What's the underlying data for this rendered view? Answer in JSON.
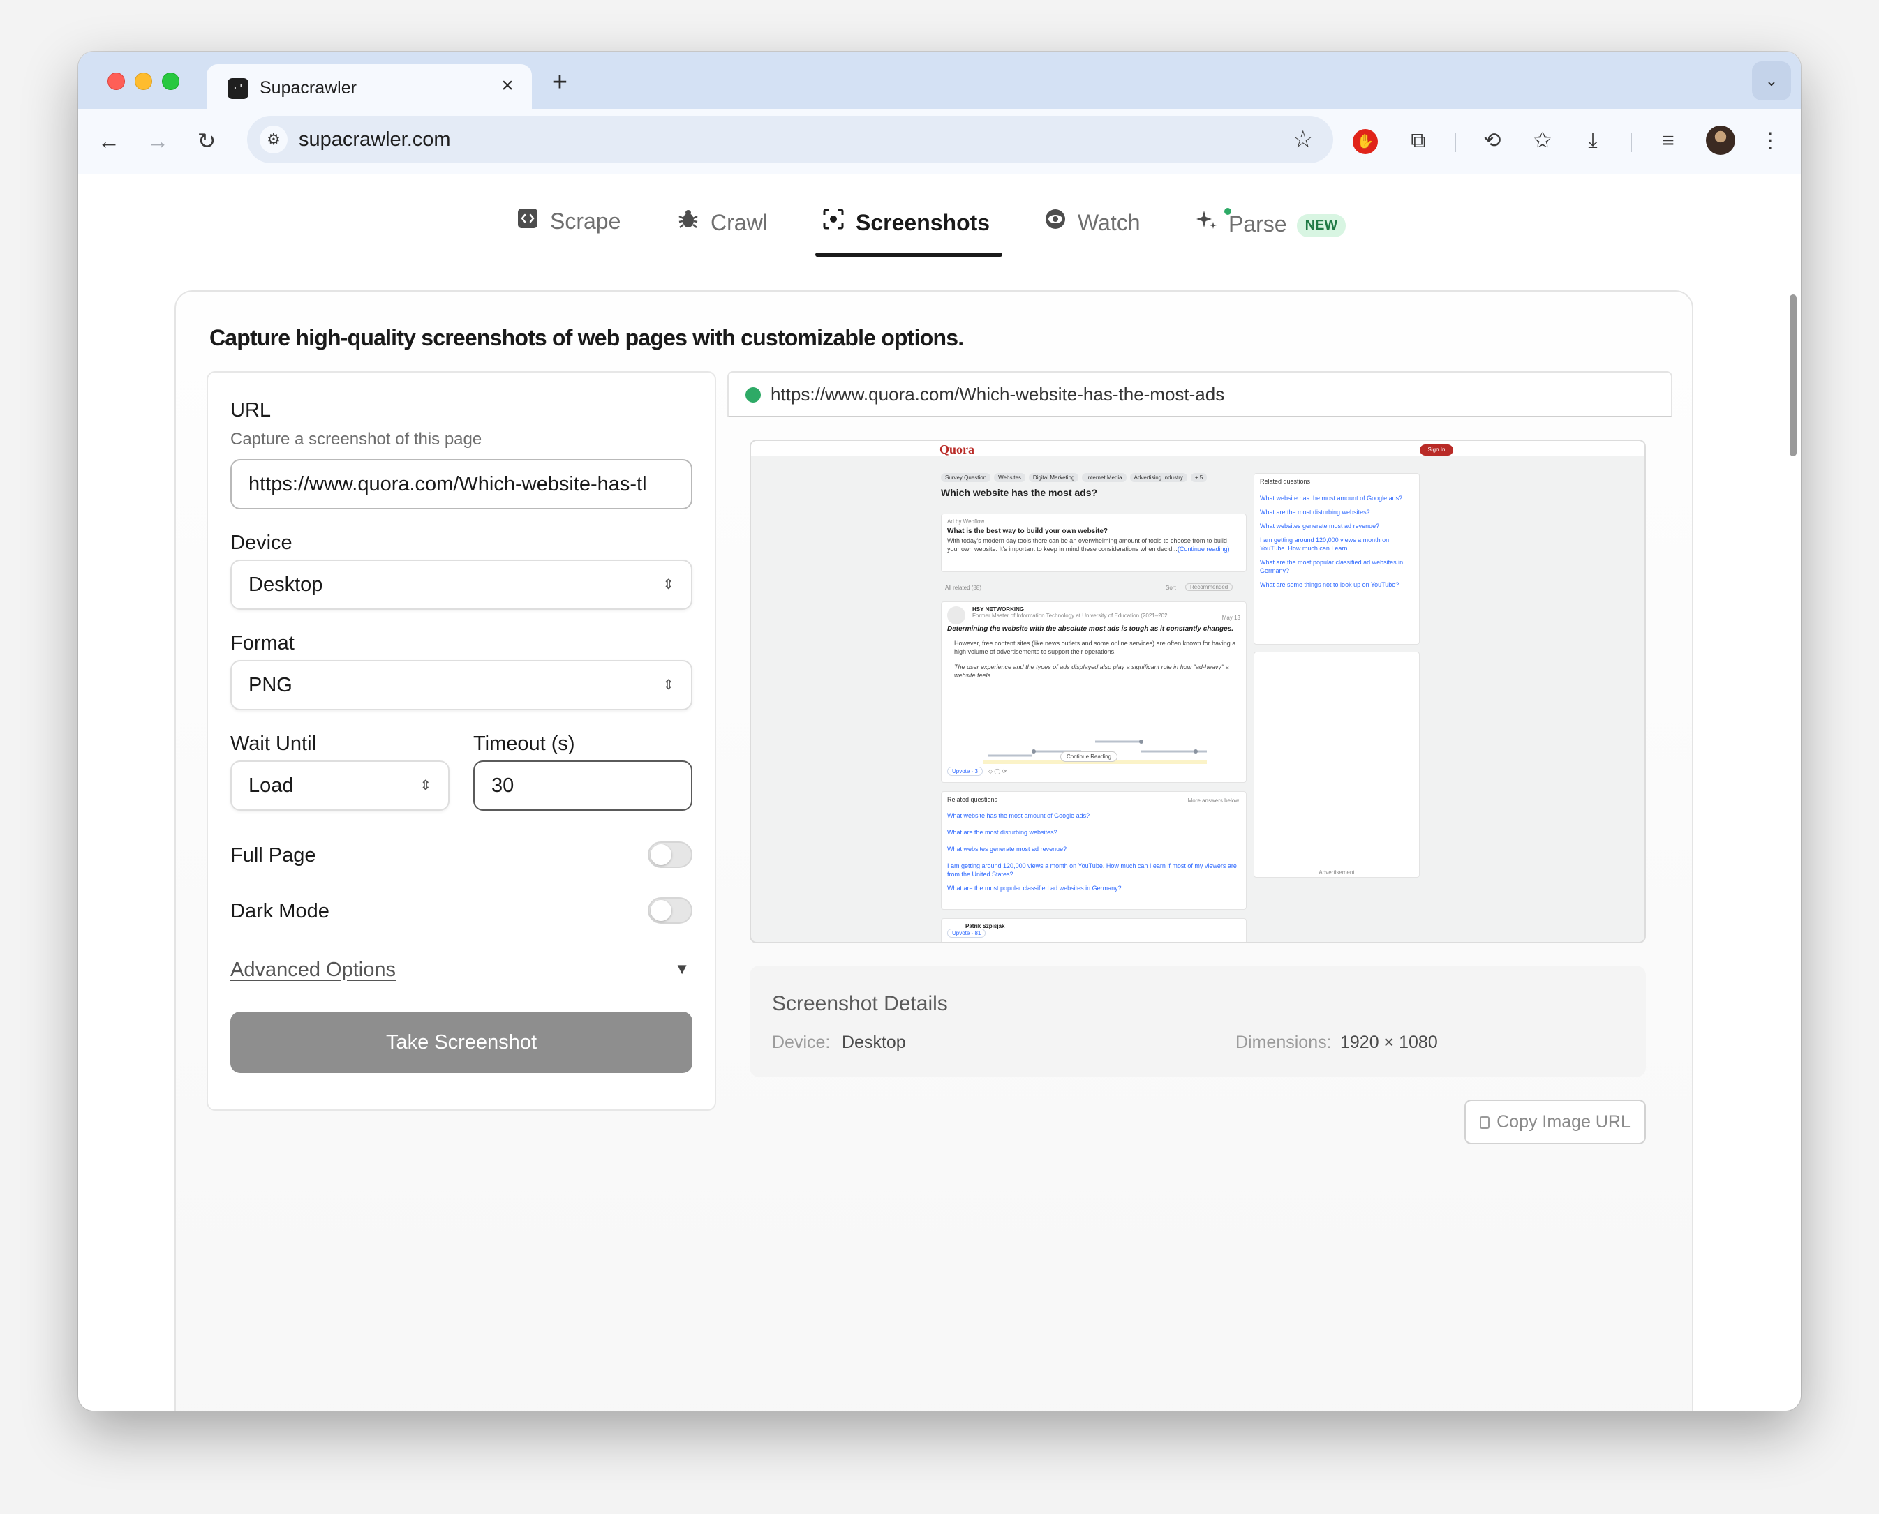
{
  "browser": {
    "tab_title": "Supacrawler",
    "favicon_glyph": "·'",
    "new_tab": "+",
    "url": "supacrawler.com"
  },
  "nav": {
    "tabs": [
      {
        "label": "Scrape",
        "icon": "code-icon"
      },
      {
        "label": "Crawl",
        "icon": "bug-icon"
      },
      {
        "label": "Screenshots",
        "icon": "screenshot-icon",
        "active": true
      },
      {
        "label": "Watch",
        "icon": "eye-icon"
      },
      {
        "label": "Parse",
        "icon": "sparkles-icon",
        "badge": "NEW"
      }
    ]
  },
  "card": {
    "headline": "Capture high-quality screenshots of web pages with customizable options."
  },
  "form": {
    "url_label": "URL",
    "url_help": "Capture a screenshot of this page",
    "url_value": "https://www.quora.com/Which-website-has-tl",
    "device_label": "Device",
    "device_value": "Desktop",
    "format_label": "Format",
    "format_value": "PNG",
    "wait_label": "Wait Until",
    "wait_value": "Load",
    "timeout_label": "Timeout (s)",
    "timeout_value": "30",
    "full_page_label": "Full Page",
    "full_page_on": false,
    "dark_mode_label": "Dark Mode",
    "dark_mode_on": false,
    "advanced_label": "Advanced Options",
    "submit_label": "Take Screenshot"
  },
  "preview": {
    "status_color": "#2eaa66",
    "url": "https://www.quora.com/Which-website-has-the-most-ads",
    "shot": {
      "logo": "Quora",
      "sign_in": "Sign In",
      "topics": [
        "Survey Question",
        "Websites",
        "Digital Marketing",
        "Internet Media",
        "Advertising Industry",
        "+ 5"
      ],
      "question": "Which website has the most ads?",
      "ad_by": "Ad by Webflow",
      "ad_title": "What is the best way to build your own website?",
      "ad_text": "With today's modern day tools there can be an overwhelming amount of tools to choose from to build your own website. It's important to keep in mind these considerations when decid...",
      "ad_more": "(Continue reading)",
      "all_related": "All related (88)",
      "sort": "Sort",
      "recommended": "Recommended",
      "answer_author": "HSY NETWORKING",
      "answer_cred": "Former Master of Information Technology at University of Education (2021–202...",
      "answer_date": "May 13",
      "answer_bold": "Determining the website with the absolute most ads is tough as it constantly changes.",
      "answer_p1": "However, free content sites (like news outlets and some online services) are often known for having a high volume of advertisements to support their operations.",
      "answer_p2": "The user experience and the types of ads displayed also play a significant role in how \"ad-heavy\" a website feels.",
      "continue": "Continue Reading",
      "upvote": "Upvote · 3",
      "related_heading": "Related questions",
      "more_answers": "More answers below",
      "related": [
        "What website has the most amount of Google ads?",
        "What are the most disturbing websites?",
        "What websites generate most ad revenue?",
        "I am getting around 120,000 views a month on YouTube. How much can I earn if most of my viewers are from the United States?",
        "What are the most popular classified ad websites in Germany?"
      ],
      "side_heading": "Related questions",
      "side_related": [
        "What website has the most amount of Google ads?",
        "What are the most disturbing websites?",
        "What websites generate most ad revenue?",
        "I am getting around 120,000 views a month on YouTube. How much can I earn...",
        "What are the most popular classified ad websites in Germany?",
        "What are some things not to look up on YouTube?"
      ],
      "advertisement": "Advertisement",
      "second_author": "Patrik Szpisják",
      "second_upvote": "Upvote · 81"
    },
    "details_title": "Screenshot Details",
    "device_key": "Device:",
    "device_val": "Desktop",
    "dimensions_key": "Dimensions:",
    "dimensions_val": "1920 × 1080",
    "copy_label": "Copy Image URL"
  }
}
